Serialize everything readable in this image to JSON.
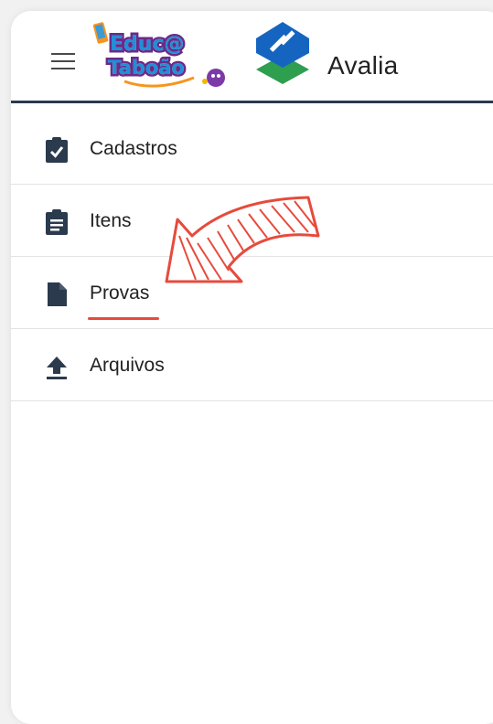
{
  "header": {
    "brand_line1": "Educ@",
    "brand_line2": "Taboão",
    "app_name": "Avalia",
    "colors": {
      "bar_divider": "#2b3a4d",
      "avalia_blue": "#1565c0",
      "avalia_green": "#2e9e4f"
    }
  },
  "nav": {
    "items": [
      {
        "label": "Cadastros",
        "icon": "clipboard-check-icon"
      },
      {
        "label": "Itens",
        "icon": "clipboard-list-icon"
      },
      {
        "label": "Provas",
        "icon": "file-icon"
      },
      {
        "label": "Arquivos",
        "icon": "upload-icon"
      }
    ]
  },
  "annotation": {
    "arrow_color": "#e64b3c",
    "highlighted_item": "Provas"
  }
}
